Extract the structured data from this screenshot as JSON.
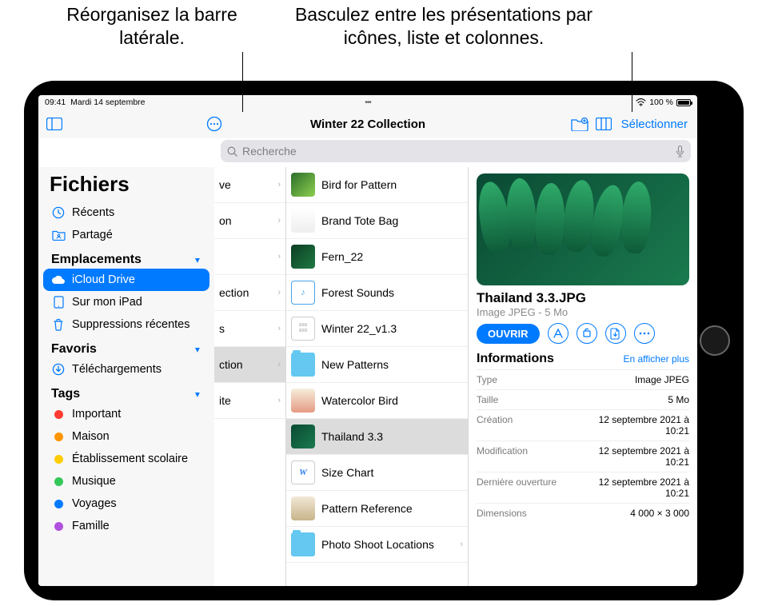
{
  "callouts": {
    "left": "Réorganisez la barre latérale.",
    "right": "Basculez entre les présentations par icônes, liste et colonnes."
  },
  "statusbar": {
    "time": "09:41",
    "date": "Mardi 14 septembre",
    "battery": "100 %",
    "wifi": "wifi",
    "battery_pct": 100
  },
  "toolbar": {
    "title": "Winter 22 Collection",
    "select": "Sélectionner"
  },
  "search": {
    "placeholder": "Recherche"
  },
  "sidebar": {
    "title": "Fichiers",
    "recents": "Récents",
    "shared": "Partagé",
    "section_locations": "Emplacements",
    "icloud": "iCloud Drive",
    "on_ipad": "Sur mon iPad",
    "trash": "Suppressions récentes",
    "section_favorites": "Favoris",
    "downloads": "Téléchargements",
    "section_tags": "Tags",
    "tags": [
      {
        "label": "Important",
        "color": "#ff3b30"
      },
      {
        "label": "Maison",
        "color": "#ff9500"
      },
      {
        "label": "Établissement scolaire",
        "color": "#ffcc00"
      },
      {
        "label": "Musique",
        "color": "#34c759"
      },
      {
        "label": "Voyages",
        "color": "#007aff"
      },
      {
        "label": "Famille",
        "color": "#af52de"
      }
    ]
  },
  "col1": [
    {
      "label": "ve"
    },
    {
      "label": "on"
    },
    {
      "label": ""
    },
    {
      "label": "ection"
    },
    {
      "label": "s"
    },
    {
      "label": "ction",
      "selected": true
    },
    {
      "label": "ite"
    }
  ],
  "col2": [
    {
      "label": "Bird for Pattern",
      "thumb": "img",
      "bg": "linear-gradient(135deg,#2a6e2a,#8ecf4f)"
    },
    {
      "label": "Brand Tote Bag",
      "thumb": "img",
      "bg": "linear-gradient(180deg,#fff,#eee)"
    },
    {
      "label": "Fern_22",
      "thumb": "img",
      "bg": "linear-gradient(135deg,#0d3d22,#1e7a44)"
    },
    {
      "label": "Forest Sounds",
      "thumb": "audio",
      "bg": "#fff"
    },
    {
      "label": "Winter 22_v1.3",
      "thumb": "doc",
      "bg": "#fff"
    },
    {
      "label": "New Patterns",
      "thumb": "folder"
    },
    {
      "label": "Watercolor Bird",
      "thumb": "img",
      "bg": "linear-gradient(180deg,#f6eedd,#e59a82)"
    },
    {
      "label": "Thailand 3.3",
      "thumb": "img",
      "bg": "linear-gradient(135deg,#0a4a34,#1a7a4e)",
      "selected": true
    },
    {
      "label": "Size Chart",
      "thumb": "w",
      "bg": "#fff"
    },
    {
      "label": "Pattern Reference",
      "thumb": "img",
      "bg": "linear-gradient(180deg,#f2e8d6,#c9b48a)"
    },
    {
      "label": "Photo Shoot Locations",
      "thumb": "folder",
      "chev": true
    }
  ],
  "preview": {
    "name": "Thailand 3.3.JPG",
    "sub": "Image JPEG - 5 Mo",
    "open": "OUVRIR",
    "info_title": "Informations",
    "info_more": "En afficher plus",
    "rows": [
      {
        "k": "Type",
        "v": "Image JPEG"
      },
      {
        "k": "Taille",
        "v": "5 Mo"
      },
      {
        "k": "Création",
        "v": "12 septembre 2021 à 10:21"
      },
      {
        "k": "Modification",
        "v": "12 septembre 2021 à 10:21"
      },
      {
        "k": "Dernière ouverture",
        "v": "12 septembre 2021 à 10:21"
      },
      {
        "k": "Dimensions",
        "v": "4 000 × 3 000"
      }
    ]
  }
}
